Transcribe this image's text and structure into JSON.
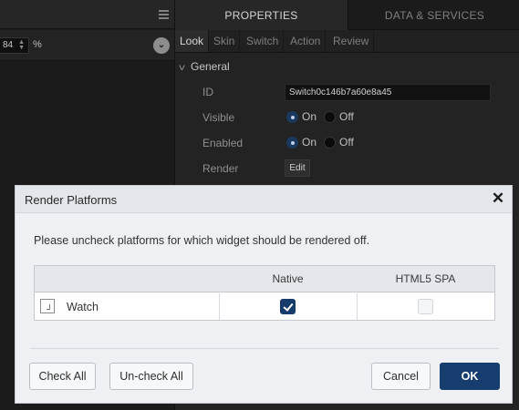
{
  "ide": {
    "toolbar": {
      "value_field": "84",
      "unit": "%"
    },
    "panel_tabs": [
      {
        "label": "PROPERTIES",
        "active": true
      },
      {
        "label": "DATA & SERVICES",
        "active": false
      }
    ],
    "sub_tabs": [
      {
        "label": "Look",
        "active": true
      },
      {
        "label": "Skin",
        "active": false
      },
      {
        "label": "Switch",
        "active": false
      },
      {
        "label": "Action",
        "active": false
      },
      {
        "label": "Review",
        "active": false
      }
    ],
    "section": {
      "title": "General",
      "properties": {
        "id_label": "ID",
        "id_value": "Switch0c146b7a60e8a45",
        "visible_label": "Visible",
        "enabled_label": "Enabled",
        "render_label": "Render",
        "render_button": "Edit",
        "on_label": "On",
        "off_label": "Off",
        "visible_value": "On",
        "enabled_value": "On"
      }
    }
  },
  "dialog": {
    "title": "Render Platforms",
    "instruction": "Please uncheck platforms for which widget should be rendered off.",
    "columns": [
      "",
      "Native",
      "HTML5 SPA"
    ],
    "rows": [
      {
        "name": "Watch",
        "native": true,
        "html5_spa": false
      }
    ],
    "buttons": {
      "check_all": "Check All",
      "uncheck_all": "Un-check All",
      "cancel": "Cancel",
      "ok": "OK"
    }
  },
  "colors": {
    "primary_button": "#163d6e",
    "checkbox_checked": "#173c6b",
    "ide_background": "#1f1f1f",
    "dialog_background": "#eef0f3"
  }
}
